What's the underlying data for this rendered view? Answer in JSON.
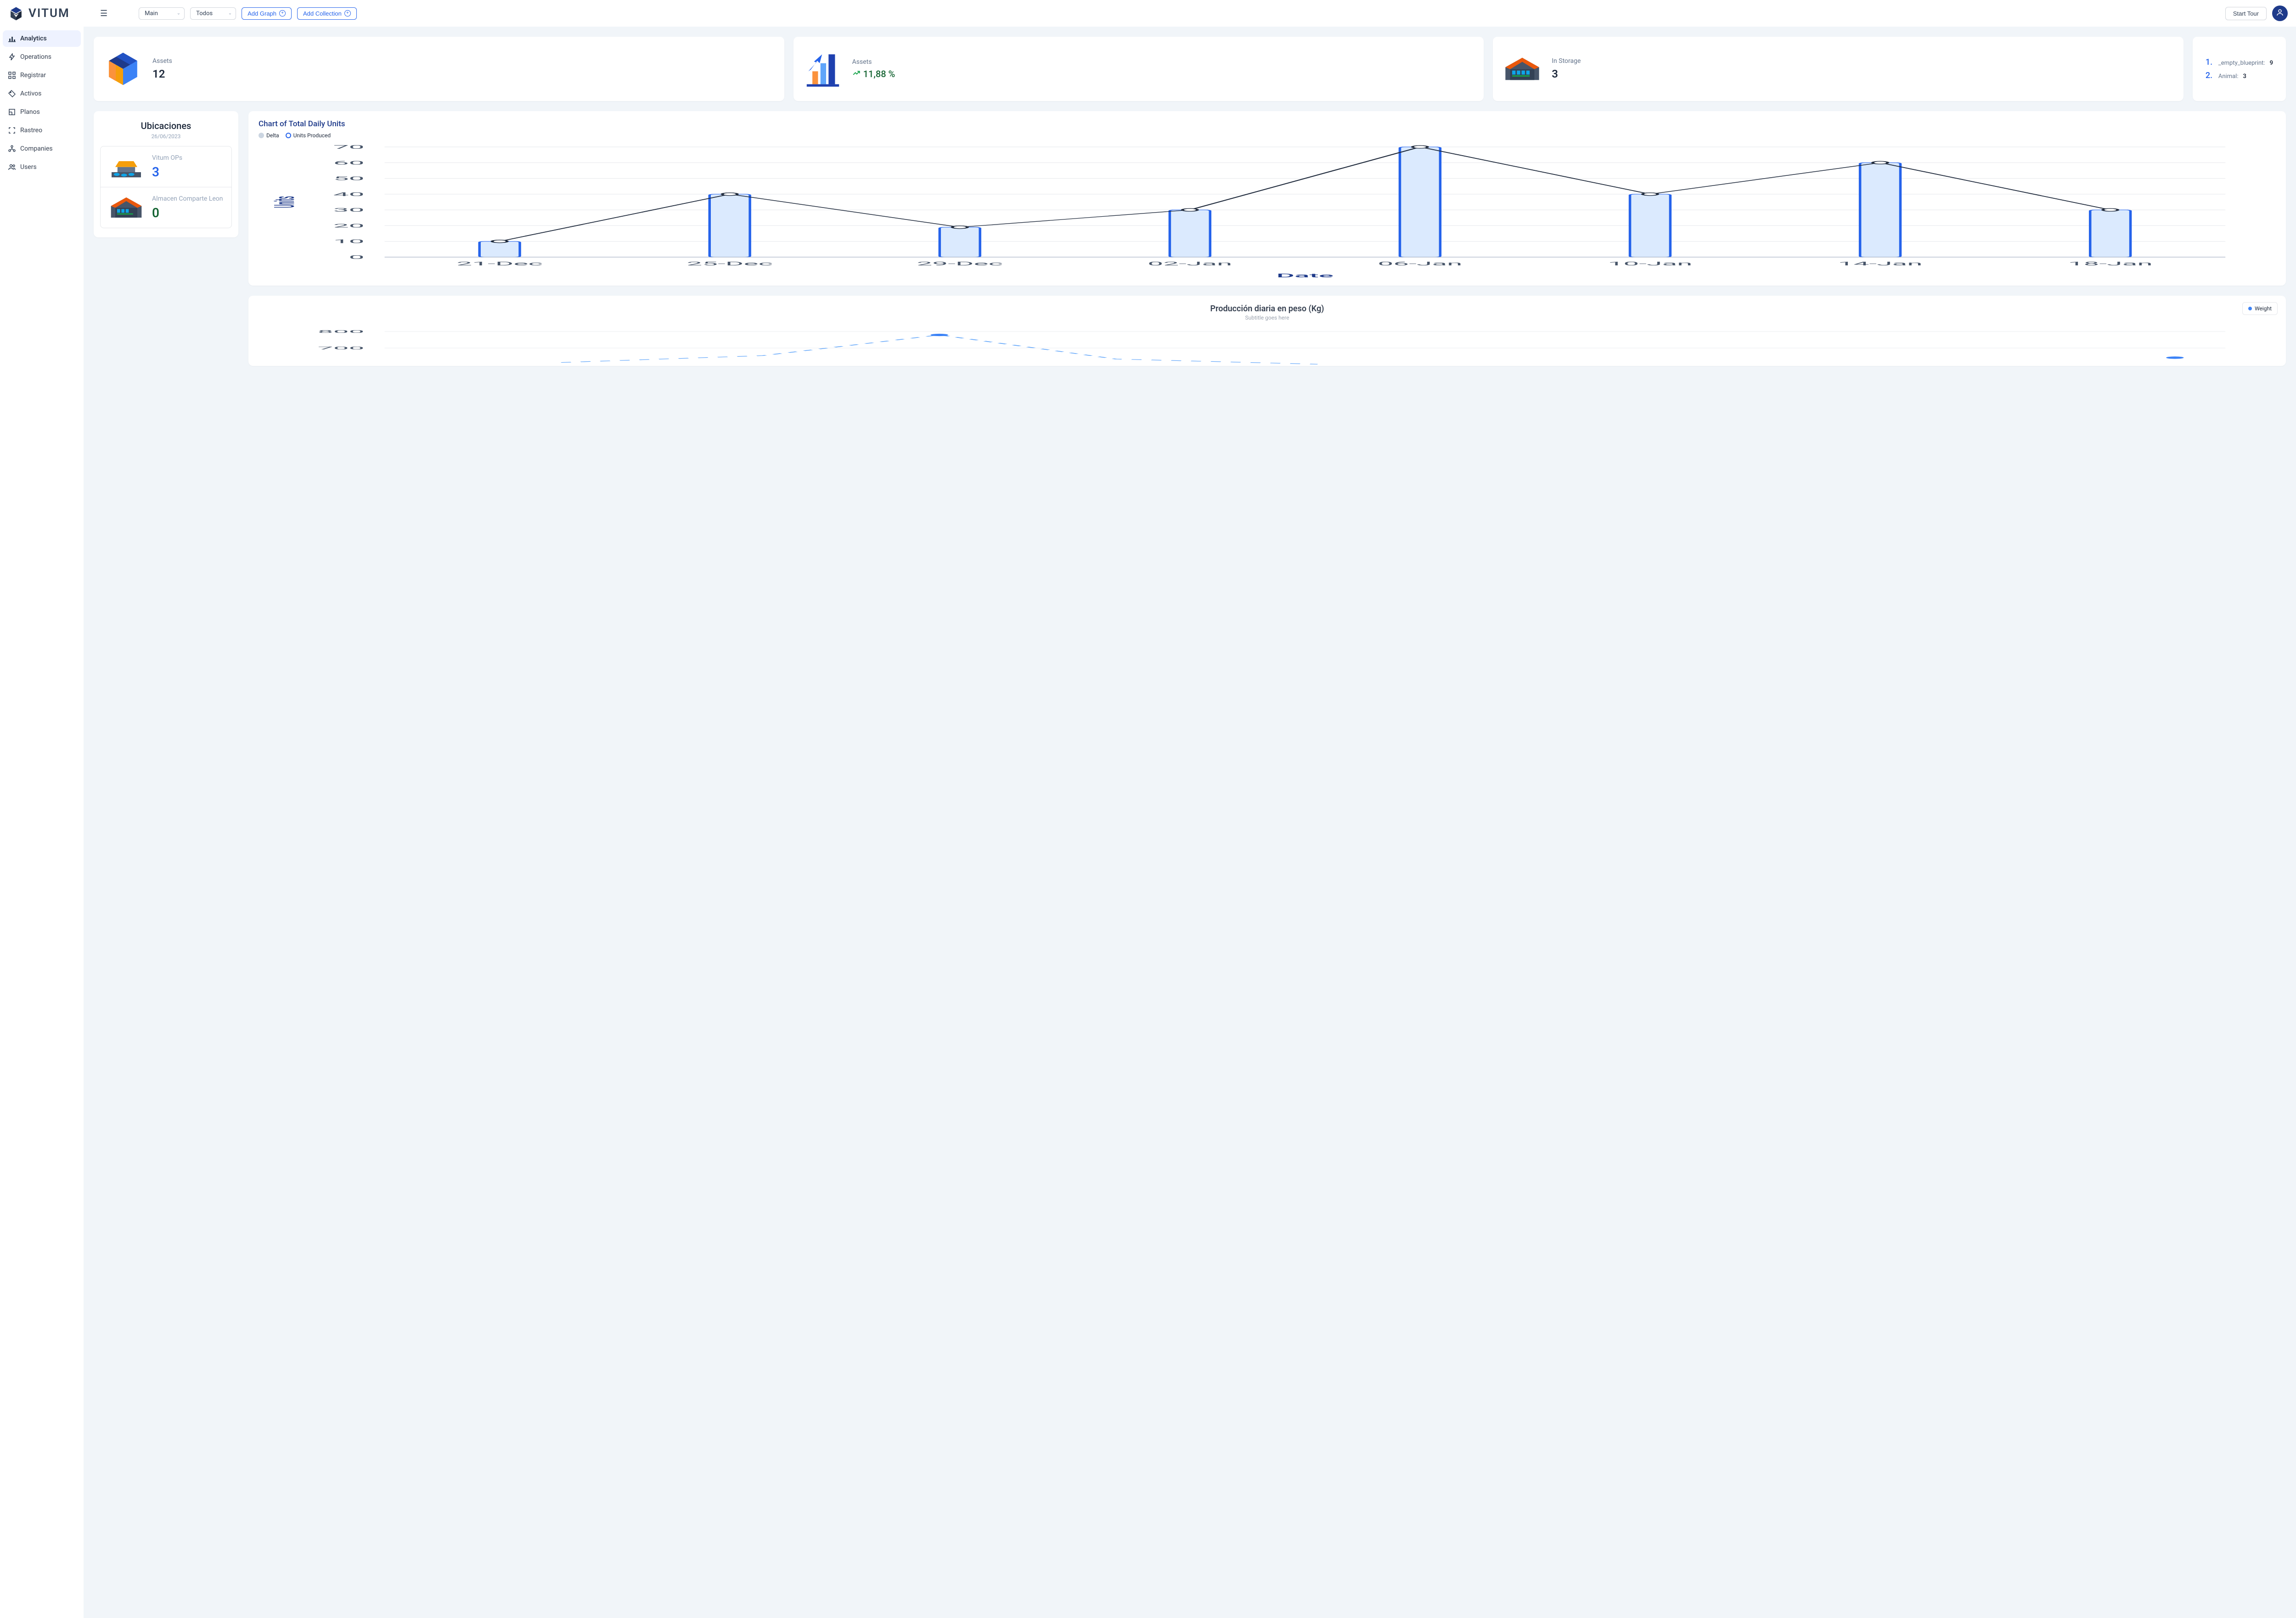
{
  "brand": "VITUM",
  "topbar": {
    "select_main": "Main",
    "select_filter": "Todos",
    "add_graph": "Add Graph",
    "add_collection": "Add Collection",
    "start_tour": "Start Tour"
  },
  "sidebar": {
    "items": [
      {
        "label": "Analytics",
        "icon": "chart-bar"
      },
      {
        "label": "Operations",
        "icon": "bolt"
      },
      {
        "label": "Registrar",
        "icon": "grid"
      },
      {
        "label": "Activos",
        "icon": "tag"
      },
      {
        "label": "Planos",
        "icon": "doc"
      },
      {
        "label": "Rastreo",
        "icon": "scan"
      },
      {
        "label": "Companies",
        "icon": "org"
      },
      {
        "label": "Users",
        "icon": "user"
      }
    ]
  },
  "stats": {
    "card1": {
      "label": "Assets",
      "value": "12"
    },
    "card2": {
      "label": "Assets",
      "value": "11,88 %"
    },
    "card3": {
      "label": "In Storage",
      "value": "3"
    },
    "ranks": [
      {
        "num": "1.",
        "label": "_empty_blueprint:",
        "value": "9"
      },
      {
        "num": "2.",
        "label": "Animal:",
        "value": "3"
      }
    ]
  },
  "ubicaciones": {
    "title": "Ubicaciones",
    "date": "26/06/2023",
    "items": [
      {
        "name": "Vitum OPs",
        "count": "3",
        "style": "blue",
        "icon": "lot"
      },
      {
        "name": "Almacen Comparte Leon",
        "count": "0",
        "style": "green",
        "icon": "wh"
      }
    ]
  },
  "chart1": {
    "title": "Chart of Total Daily Units",
    "legend": {
      "a": "Delta",
      "b": "Units Produced"
    },
    "xlabel": "Date",
    "ylabel": "Units"
  },
  "chart2": {
    "title": "Producción diaria en peso (Kg)",
    "subtitle": "Subtitle goes here",
    "legend": "Weight"
  },
  "chart_data": [
    {
      "type": "bar",
      "title": "Chart of Total Daily Units",
      "xlabel": "Date",
      "ylabel": "Units",
      "ylim": [
        0,
        70
      ],
      "categories": [
        "21-Dec",
        "25-Dec",
        "29-Dec",
        "02-Jan",
        "06-Jan",
        "10-Jan",
        "14-Jan",
        "18-Jan"
      ],
      "series": [
        {
          "name": "Units Produced",
          "values": [
            10,
            40,
            19,
            30,
            70,
            40,
            60,
            30
          ]
        },
        {
          "name": "Delta",
          "values": [
            10,
            40,
            19,
            30,
            70,
            40,
            60,
            30
          ]
        }
      ]
    },
    {
      "type": "line",
      "title": "Producción diaria en peso (Kg)",
      "subtitle": "Subtitle goes here",
      "ylabel": "Weight",
      "y_ticks_visible": [
        800,
        700
      ],
      "series": [
        {
          "name": "Weight",
          "partial_values": [
            null,
            null,
            770,
            null,
            null
          ]
        }
      ]
    }
  ]
}
